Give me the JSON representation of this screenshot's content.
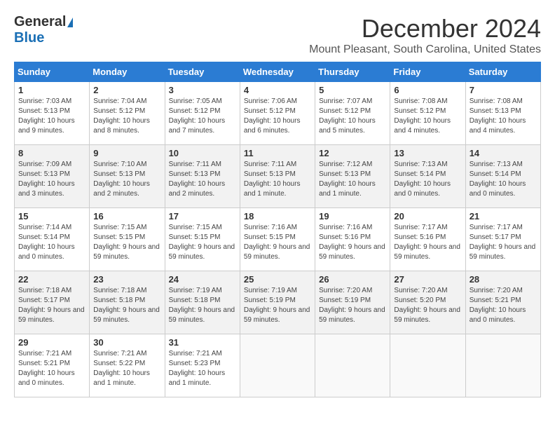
{
  "logo": {
    "general": "General",
    "blue": "Blue"
  },
  "title": {
    "month": "December 2024",
    "location": "Mount Pleasant, South Carolina, United States"
  },
  "weekdays": [
    "Sunday",
    "Monday",
    "Tuesday",
    "Wednesday",
    "Thursday",
    "Friday",
    "Saturday"
  ],
  "weeks": [
    [
      {
        "day": "1",
        "sunrise": "Sunrise: 7:03 AM",
        "sunset": "Sunset: 5:13 PM",
        "daylight": "Daylight: 10 hours and 9 minutes."
      },
      {
        "day": "2",
        "sunrise": "Sunrise: 7:04 AM",
        "sunset": "Sunset: 5:12 PM",
        "daylight": "Daylight: 10 hours and 8 minutes."
      },
      {
        "day": "3",
        "sunrise": "Sunrise: 7:05 AM",
        "sunset": "Sunset: 5:12 PM",
        "daylight": "Daylight: 10 hours and 7 minutes."
      },
      {
        "day": "4",
        "sunrise": "Sunrise: 7:06 AM",
        "sunset": "Sunset: 5:12 PM",
        "daylight": "Daylight: 10 hours and 6 minutes."
      },
      {
        "day": "5",
        "sunrise": "Sunrise: 7:07 AM",
        "sunset": "Sunset: 5:12 PM",
        "daylight": "Daylight: 10 hours and 5 minutes."
      },
      {
        "day": "6",
        "sunrise": "Sunrise: 7:08 AM",
        "sunset": "Sunset: 5:12 PM",
        "daylight": "Daylight: 10 hours and 4 minutes."
      },
      {
        "day": "7",
        "sunrise": "Sunrise: 7:08 AM",
        "sunset": "Sunset: 5:13 PM",
        "daylight": "Daylight: 10 hours and 4 minutes."
      }
    ],
    [
      {
        "day": "8",
        "sunrise": "Sunrise: 7:09 AM",
        "sunset": "Sunset: 5:13 PM",
        "daylight": "Daylight: 10 hours and 3 minutes."
      },
      {
        "day": "9",
        "sunrise": "Sunrise: 7:10 AM",
        "sunset": "Sunset: 5:13 PM",
        "daylight": "Daylight: 10 hours and 2 minutes."
      },
      {
        "day": "10",
        "sunrise": "Sunrise: 7:11 AM",
        "sunset": "Sunset: 5:13 PM",
        "daylight": "Daylight: 10 hours and 2 minutes."
      },
      {
        "day": "11",
        "sunrise": "Sunrise: 7:11 AM",
        "sunset": "Sunset: 5:13 PM",
        "daylight": "Daylight: 10 hours and 1 minute."
      },
      {
        "day": "12",
        "sunrise": "Sunrise: 7:12 AM",
        "sunset": "Sunset: 5:13 PM",
        "daylight": "Daylight: 10 hours and 1 minute."
      },
      {
        "day": "13",
        "sunrise": "Sunrise: 7:13 AM",
        "sunset": "Sunset: 5:14 PM",
        "daylight": "Daylight: 10 hours and 0 minutes."
      },
      {
        "day": "14",
        "sunrise": "Sunrise: 7:13 AM",
        "sunset": "Sunset: 5:14 PM",
        "daylight": "Daylight: 10 hours and 0 minutes."
      }
    ],
    [
      {
        "day": "15",
        "sunrise": "Sunrise: 7:14 AM",
        "sunset": "Sunset: 5:14 PM",
        "daylight": "Daylight: 10 hours and 0 minutes."
      },
      {
        "day": "16",
        "sunrise": "Sunrise: 7:15 AM",
        "sunset": "Sunset: 5:15 PM",
        "daylight": "Daylight: 9 hours and 59 minutes."
      },
      {
        "day": "17",
        "sunrise": "Sunrise: 7:15 AM",
        "sunset": "Sunset: 5:15 PM",
        "daylight": "Daylight: 9 hours and 59 minutes."
      },
      {
        "day": "18",
        "sunrise": "Sunrise: 7:16 AM",
        "sunset": "Sunset: 5:15 PM",
        "daylight": "Daylight: 9 hours and 59 minutes."
      },
      {
        "day": "19",
        "sunrise": "Sunrise: 7:16 AM",
        "sunset": "Sunset: 5:16 PM",
        "daylight": "Daylight: 9 hours and 59 minutes."
      },
      {
        "day": "20",
        "sunrise": "Sunrise: 7:17 AM",
        "sunset": "Sunset: 5:16 PM",
        "daylight": "Daylight: 9 hours and 59 minutes."
      },
      {
        "day": "21",
        "sunrise": "Sunrise: 7:17 AM",
        "sunset": "Sunset: 5:17 PM",
        "daylight": "Daylight: 9 hours and 59 minutes."
      }
    ],
    [
      {
        "day": "22",
        "sunrise": "Sunrise: 7:18 AM",
        "sunset": "Sunset: 5:17 PM",
        "daylight": "Daylight: 9 hours and 59 minutes."
      },
      {
        "day": "23",
        "sunrise": "Sunrise: 7:18 AM",
        "sunset": "Sunset: 5:18 PM",
        "daylight": "Daylight: 9 hours and 59 minutes."
      },
      {
        "day": "24",
        "sunrise": "Sunrise: 7:19 AM",
        "sunset": "Sunset: 5:18 PM",
        "daylight": "Daylight: 9 hours and 59 minutes."
      },
      {
        "day": "25",
        "sunrise": "Sunrise: 7:19 AM",
        "sunset": "Sunset: 5:19 PM",
        "daylight": "Daylight: 9 hours and 59 minutes."
      },
      {
        "day": "26",
        "sunrise": "Sunrise: 7:20 AM",
        "sunset": "Sunset: 5:19 PM",
        "daylight": "Daylight: 9 hours and 59 minutes."
      },
      {
        "day": "27",
        "sunrise": "Sunrise: 7:20 AM",
        "sunset": "Sunset: 5:20 PM",
        "daylight": "Daylight: 9 hours and 59 minutes."
      },
      {
        "day": "28",
        "sunrise": "Sunrise: 7:20 AM",
        "sunset": "Sunset: 5:21 PM",
        "daylight": "Daylight: 10 hours and 0 minutes."
      }
    ],
    [
      {
        "day": "29",
        "sunrise": "Sunrise: 7:21 AM",
        "sunset": "Sunset: 5:21 PM",
        "daylight": "Daylight: 10 hours and 0 minutes."
      },
      {
        "day": "30",
        "sunrise": "Sunrise: 7:21 AM",
        "sunset": "Sunset: 5:22 PM",
        "daylight": "Daylight: 10 hours and 1 minute."
      },
      {
        "day": "31",
        "sunrise": "Sunrise: 7:21 AM",
        "sunset": "Sunset: 5:23 PM",
        "daylight": "Daylight: 10 hours and 1 minute."
      },
      null,
      null,
      null,
      null
    ]
  ]
}
